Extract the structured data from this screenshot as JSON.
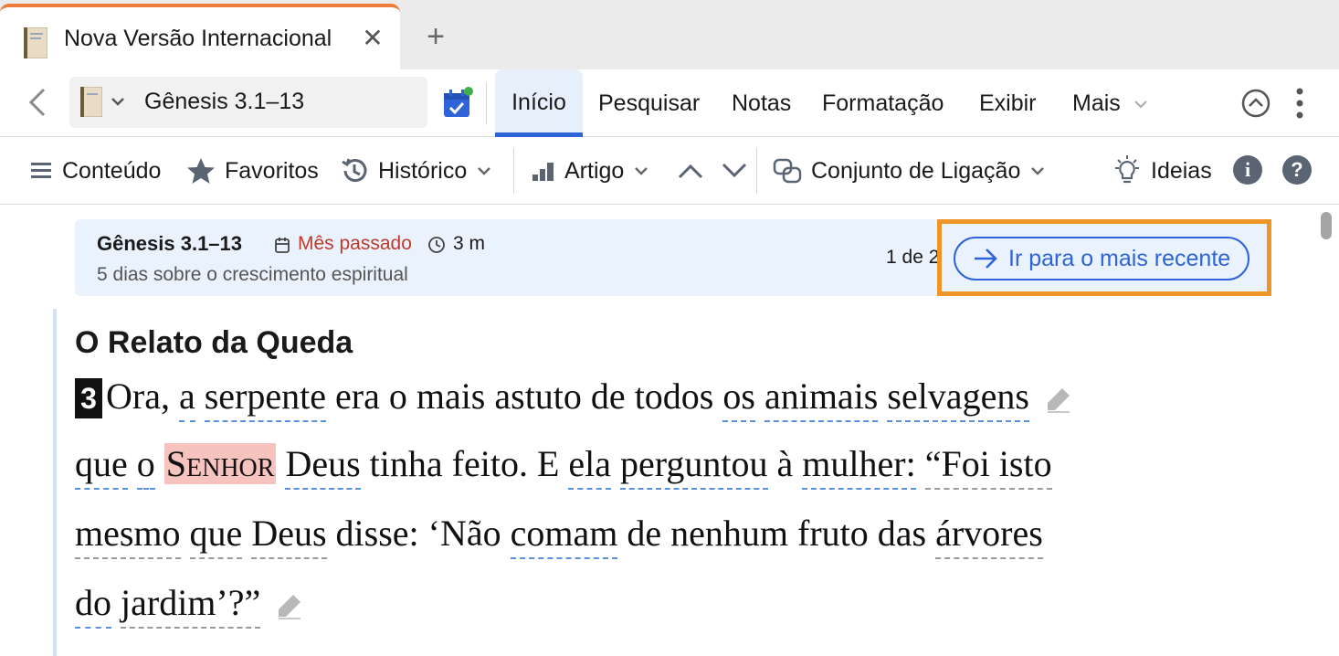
{
  "tab": {
    "title": "Nova Versão Internacional",
    "close_label": "✕",
    "new_tab_label": "+",
    "accent_color": "#ef7b3a"
  },
  "nav": {
    "reference": "Gênesis 3.1–13",
    "menu": [
      {
        "label": "Início",
        "active": true
      },
      {
        "label": "Pesquisar"
      },
      {
        "label": "Notas"
      },
      {
        "label": "Formatação"
      },
      {
        "label": "Exibir"
      },
      {
        "label": "Mais"
      }
    ],
    "icons": [
      "chevron-left-icon",
      "book-icon",
      "calendar-check-icon",
      "chevron-up-circle-icon",
      "kebab-icon"
    ]
  },
  "toolbar": {
    "conteudo": "Conteúdo",
    "favoritos": "Favoritos",
    "historico": "Histórico",
    "artigo": "Artigo",
    "conjunto": "Conjunto de Ligação",
    "ideias": "Ideias",
    "info": "i",
    "help": "?"
  },
  "banner": {
    "reference": "Gênesis 3.1–13",
    "date": "Mês passado",
    "duration": "3 m",
    "subtitle": "5 dias sobre o crescimento espiritual",
    "count": "1 de 2",
    "goto_label": "Ir para o mais recente",
    "highlight_color": "#ef9426",
    "date_color": "#c0392b"
  },
  "passage": {
    "heading": "O Relato da Queda",
    "verse_number": "3",
    "lines": [
      [
        "Ora,",
        "a",
        "serpente",
        "era",
        "o",
        "mais",
        "astuto",
        "de",
        "todos",
        "os",
        "animais",
        "selvagens"
      ],
      [
        "que",
        "o",
        "Senhor",
        "Deus",
        "tinha",
        "feito.",
        "E",
        "ela",
        "perguntou",
        "à",
        "mulher:",
        "“Foi isto"
      ],
      [
        "mesmo",
        "que",
        "Deus",
        "disse:",
        "‘Não",
        "comam",
        "de",
        "nenhum",
        "fruto",
        "das",
        "árvores"
      ],
      [
        "do",
        "jardim’?”"
      ]
    ]
  }
}
